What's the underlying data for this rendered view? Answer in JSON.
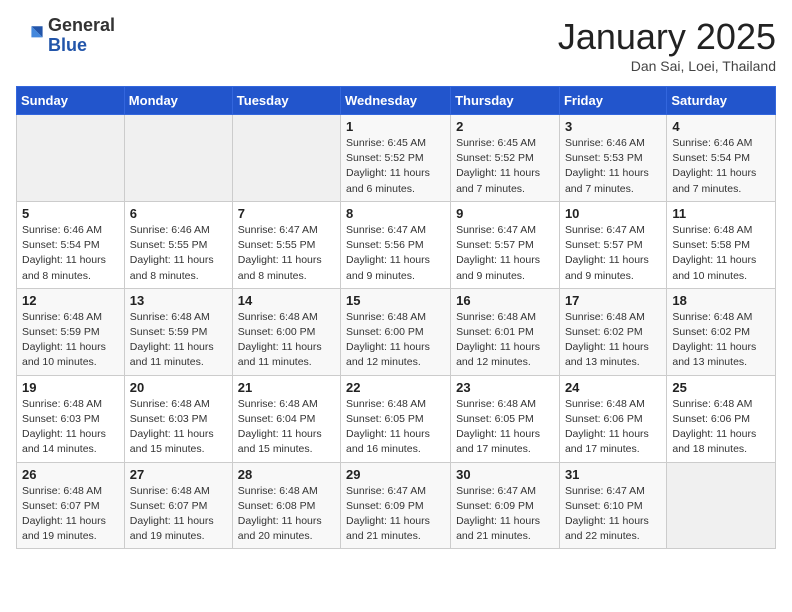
{
  "header": {
    "logo_general": "General",
    "logo_blue": "Blue",
    "title": "January 2025",
    "location": "Dan Sai, Loei, Thailand"
  },
  "days_of_week": [
    "Sunday",
    "Monday",
    "Tuesday",
    "Wednesday",
    "Thursday",
    "Friday",
    "Saturday"
  ],
  "weeks": [
    [
      {
        "day": "",
        "info": ""
      },
      {
        "day": "",
        "info": ""
      },
      {
        "day": "",
        "info": ""
      },
      {
        "day": "1",
        "info": "Sunrise: 6:45 AM\nSunset: 5:52 PM\nDaylight: 11 hours and 6 minutes."
      },
      {
        "day": "2",
        "info": "Sunrise: 6:45 AM\nSunset: 5:52 PM\nDaylight: 11 hours and 7 minutes."
      },
      {
        "day": "3",
        "info": "Sunrise: 6:46 AM\nSunset: 5:53 PM\nDaylight: 11 hours and 7 minutes."
      },
      {
        "day": "4",
        "info": "Sunrise: 6:46 AM\nSunset: 5:54 PM\nDaylight: 11 hours and 7 minutes."
      }
    ],
    [
      {
        "day": "5",
        "info": "Sunrise: 6:46 AM\nSunset: 5:54 PM\nDaylight: 11 hours and 8 minutes."
      },
      {
        "day": "6",
        "info": "Sunrise: 6:46 AM\nSunset: 5:55 PM\nDaylight: 11 hours and 8 minutes."
      },
      {
        "day": "7",
        "info": "Sunrise: 6:47 AM\nSunset: 5:55 PM\nDaylight: 11 hours and 8 minutes."
      },
      {
        "day": "8",
        "info": "Sunrise: 6:47 AM\nSunset: 5:56 PM\nDaylight: 11 hours and 9 minutes."
      },
      {
        "day": "9",
        "info": "Sunrise: 6:47 AM\nSunset: 5:57 PM\nDaylight: 11 hours and 9 minutes."
      },
      {
        "day": "10",
        "info": "Sunrise: 6:47 AM\nSunset: 5:57 PM\nDaylight: 11 hours and 9 minutes."
      },
      {
        "day": "11",
        "info": "Sunrise: 6:48 AM\nSunset: 5:58 PM\nDaylight: 11 hours and 10 minutes."
      }
    ],
    [
      {
        "day": "12",
        "info": "Sunrise: 6:48 AM\nSunset: 5:59 PM\nDaylight: 11 hours and 10 minutes."
      },
      {
        "day": "13",
        "info": "Sunrise: 6:48 AM\nSunset: 5:59 PM\nDaylight: 11 hours and 11 minutes."
      },
      {
        "day": "14",
        "info": "Sunrise: 6:48 AM\nSunset: 6:00 PM\nDaylight: 11 hours and 11 minutes."
      },
      {
        "day": "15",
        "info": "Sunrise: 6:48 AM\nSunset: 6:00 PM\nDaylight: 11 hours and 12 minutes."
      },
      {
        "day": "16",
        "info": "Sunrise: 6:48 AM\nSunset: 6:01 PM\nDaylight: 11 hours and 12 minutes."
      },
      {
        "day": "17",
        "info": "Sunrise: 6:48 AM\nSunset: 6:02 PM\nDaylight: 11 hours and 13 minutes."
      },
      {
        "day": "18",
        "info": "Sunrise: 6:48 AM\nSunset: 6:02 PM\nDaylight: 11 hours and 13 minutes."
      }
    ],
    [
      {
        "day": "19",
        "info": "Sunrise: 6:48 AM\nSunset: 6:03 PM\nDaylight: 11 hours and 14 minutes."
      },
      {
        "day": "20",
        "info": "Sunrise: 6:48 AM\nSunset: 6:03 PM\nDaylight: 11 hours and 15 minutes."
      },
      {
        "day": "21",
        "info": "Sunrise: 6:48 AM\nSunset: 6:04 PM\nDaylight: 11 hours and 15 minutes."
      },
      {
        "day": "22",
        "info": "Sunrise: 6:48 AM\nSunset: 6:05 PM\nDaylight: 11 hours and 16 minutes."
      },
      {
        "day": "23",
        "info": "Sunrise: 6:48 AM\nSunset: 6:05 PM\nDaylight: 11 hours and 17 minutes."
      },
      {
        "day": "24",
        "info": "Sunrise: 6:48 AM\nSunset: 6:06 PM\nDaylight: 11 hours and 17 minutes."
      },
      {
        "day": "25",
        "info": "Sunrise: 6:48 AM\nSunset: 6:06 PM\nDaylight: 11 hours and 18 minutes."
      }
    ],
    [
      {
        "day": "26",
        "info": "Sunrise: 6:48 AM\nSunset: 6:07 PM\nDaylight: 11 hours and 19 minutes."
      },
      {
        "day": "27",
        "info": "Sunrise: 6:48 AM\nSunset: 6:07 PM\nDaylight: 11 hours and 19 minutes."
      },
      {
        "day": "28",
        "info": "Sunrise: 6:48 AM\nSunset: 6:08 PM\nDaylight: 11 hours and 20 minutes."
      },
      {
        "day": "29",
        "info": "Sunrise: 6:47 AM\nSunset: 6:09 PM\nDaylight: 11 hours and 21 minutes."
      },
      {
        "day": "30",
        "info": "Sunrise: 6:47 AM\nSunset: 6:09 PM\nDaylight: 11 hours and 21 minutes."
      },
      {
        "day": "31",
        "info": "Sunrise: 6:47 AM\nSunset: 6:10 PM\nDaylight: 11 hours and 22 minutes."
      },
      {
        "day": "",
        "info": ""
      }
    ]
  ]
}
